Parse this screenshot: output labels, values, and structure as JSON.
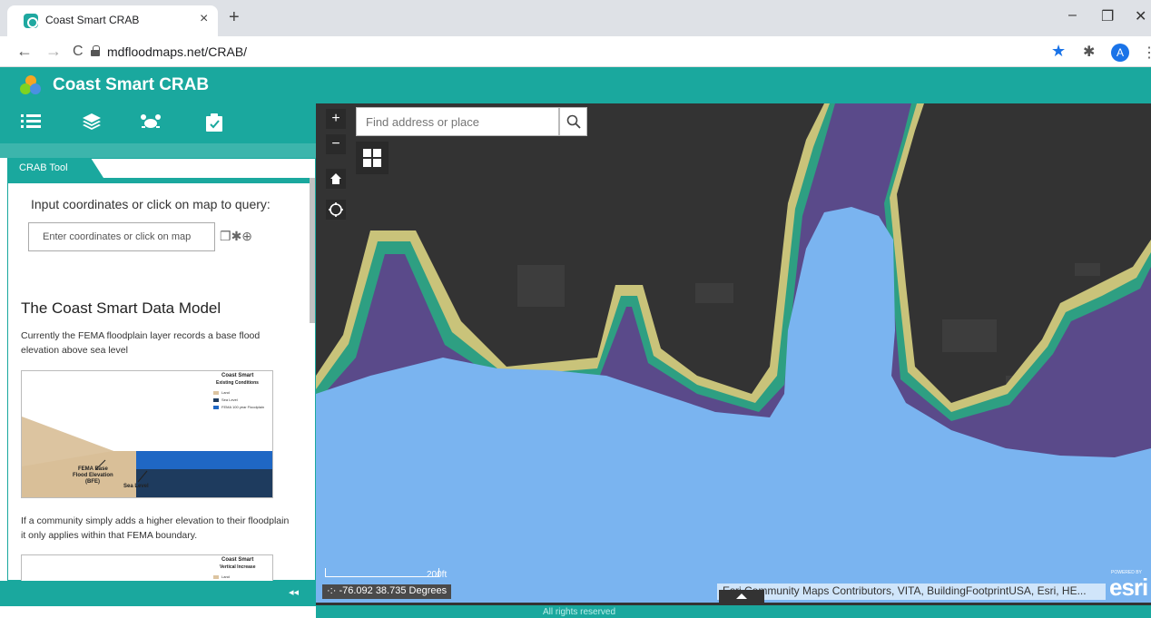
{
  "browser": {
    "tab_title": "Coast Smart CRAB",
    "close_tab": "×",
    "new_tab": "+",
    "url": "mdfloodmaps.net/CRAB/",
    "profile_initial": "A",
    "back": "←",
    "forward": "→",
    "reload": "C",
    "minimize": "–",
    "restore": "❐",
    "close_window": "✕",
    "menu": "⋮",
    "bookmark_star": "★",
    "extensions": "✱"
  },
  "app": {
    "title": "Coast Smart CRAB",
    "toolbar_icons": [
      "list-icon",
      "layers-icon",
      "crab-icon",
      "clipboard-icon"
    ]
  },
  "panel": {
    "tab_label": "CRAB Tool",
    "hint": "Input coordinates or click on map to query:",
    "coord_placeholder": "Enter coordinates or click on map",
    "heading": "The Coast Smart Data Model",
    "para1": "Currently the FEMA floodplain layer records a base flood elevation above sea level",
    "para2": "If a community simply adds a higher elevation to their floodplain it only applies within that FEMA boundary.",
    "collapse_label": "◂◂",
    "figure1": {
      "title": "Coast Smart",
      "subtitle": "Existing Conditions",
      "legend": [
        "Land",
        "Sea Level",
        "FEMA 100 year Floodplain"
      ],
      "label_bfe_1": "FEMA Base",
      "label_bfe_2": "Flood Elevation",
      "label_bfe_3": "(BFE)",
      "label_sea": "Sea Level"
    },
    "figure2": {
      "title": "Coast Smart",
      "subtitle": "Vertical Increase",
      "legend_first": "Land"
    }
  },
  "map": {
    "search_placeholder": "Find address or place",
    "zoom_in": "+",
    "zoom_out": "−",
    "scale_label": "200ft",
    "coordinates": "-76.092 38.735 Degrees",
    "attribution": "Esri Community Maps Contributors, VITA, BuildingFootprintUSA, Esri, HE...",
    "powered_by": "POWERED BY",
    "esri_logo": "esri",
    "footer": "All rights reserved",
    "colors": {
      "water": "#7ab4f0",
      "floodplain": "#5a4a8a",
      "land_band": "#c9c37a",
      "green_band": "#2e9f82",
      "land": "#333333",
      "teal": "#1aa89e"
    }
  }
}
